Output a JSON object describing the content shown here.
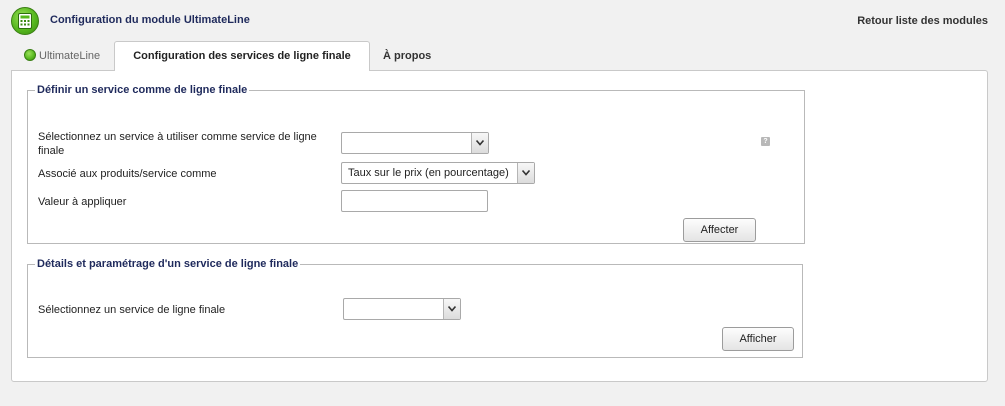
{
  "header": {
    "module_title": "Configuration du module UltimateLine",
    "back_link": "Retour liste des modules",
    "logo_icon": "calculator-icon"
  },
  "tabs": [
    {
      "label": "UltimateLine",
      "icon": "ultimateline-icon"
    },
    {
      "label": "Configuration des services de ligne finale",
      "active": true
    },
    {
      "label": "À propos"
    }
  ],
  "section_define": {
    "legend": "Définir un service comme de ligne finale",
    "service_label": "Sélectionnez un service à utiliser comme service de ligne finale",
    "service_value": "",
    "help_icon": "help-icon",
    "associate_label": "Associé aux produits/service comme",
    "associate_value": "Taux sur le prix (en pourcentage)",
    "amount_label": "Valeur à appliquer",
    "amount_value": "",
    "submit_label": "Affecter"
  },
  "section_details": {
    "legend": "Détails et paramétrage d'un service de ligne finale",
    "service_label": "Sélectionnez un service de ligne finale",
    "service_value": "",
    "submit_label": "Afficher"
  },
  "colors": {
    "accent": "#1f2a5c",
    "brand_green": "#56b81e",
    "background": "#f1f1f1"
  }
}
